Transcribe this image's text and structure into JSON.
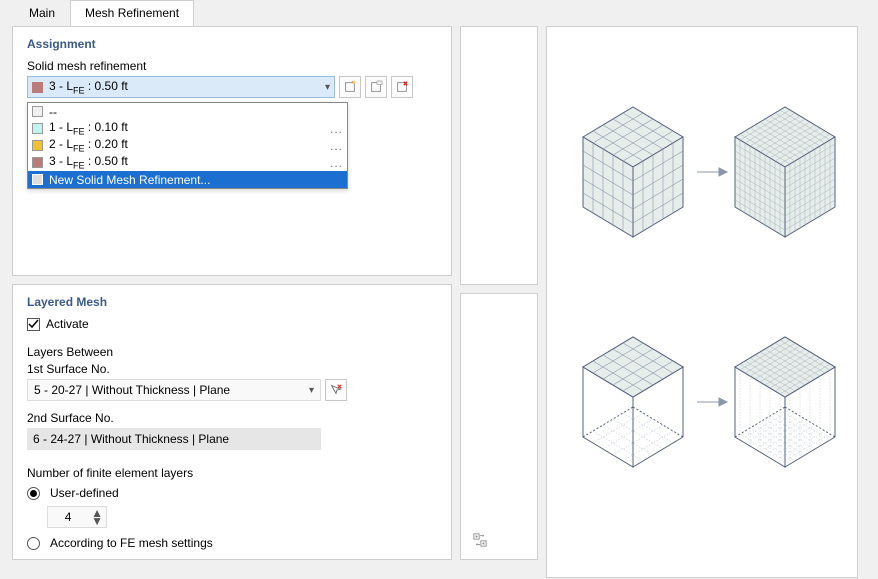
{
  "tabs": {
    "main": "Main",
    "mesh": "Mesh Refinement"
  },
  "assignment": {
    "title": "Assignment",
    "field_label": "Solid mesh refinement",
    "selected_swatch": "#bb7b7b",
    "selected_text": "3 - L  : 0.50 ft",
    "selected_sub": "FE",
    "dropdown": [
      {
        "swatch": "#e8e8e8",
        "text": "--",
        "ell": false
      },
      {
        "swatch": "#c3f3ee",
        "text": "1 - L  : 0.10 ft",
        "sub": "FE",
        "ell": true
      },
      {
        "swatch": "#f0c232",
        "text": "2 - L  : 0.20 ft",
        "sub": "FE",
        "ell": true
      },
      {
        "swatch": "#bb7b7b",
        "text": "3 - L  : 0.50 ft",
        "sub": "FE",
        "ell": true
      },
      {
        "swatch_sel": "#e8e8e8",
        "text": "New Solid Mesh Refinement...",
        "selected": true
      }
    ]
  },
  "layered": {
    "title": "Layered Mesh",
    "activate": "Activate",
    "layers_between": "Layers Between",
    "first_label": "1st Surface No.",
    "first_value": "5 - 20-27 | Without Thickness | Plane",
    "second_label": "2nd Surface No.",
    "second_value": "6 - 24-27 | Without Thickness | Plane",
    "num_layers_label": "Number of finite element layers",
    "user_defined": "User-defined",
    "user_value": "4",
    "according": "According to FE mesh settings"
  }
}
